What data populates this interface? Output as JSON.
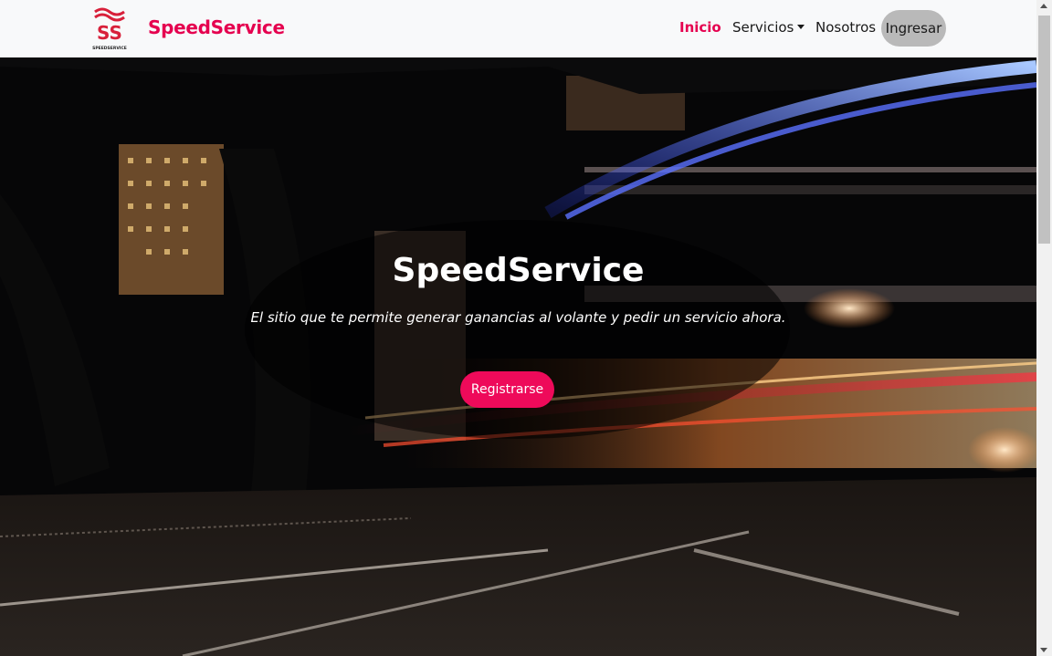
{
  "brand": {
    "logo_icon": "speedservice-logo-icon",
    "logo_text": "SS",
    "logo_caption": "SPEEDSERVICE",
    "name": "SpeedService"
  },
  "nav": {
    "inicio": "Inicio",
    "servicios": "Servicios",
    "nosotros": "Nosotros",
    "ingresar": "Ingresar",
    "dropdown_icon": "caret-down-icon"
  },
  "hero": {
    "title": "SpeedService",
    "subtitle": "El sitio que te permite generar ganancias al volante y pedir un servicio ahora.",
    "button": "Registrarse",
    "background": "night-city-bridge-light-trails-image"
  },
  "colors": {
    "brand": "#e5004f",
    "button": "#ee0a5a",
    "navbar_bg": "#f8f9fa",
    "ingresar_bg": "#b9b9b9"
  }
}
